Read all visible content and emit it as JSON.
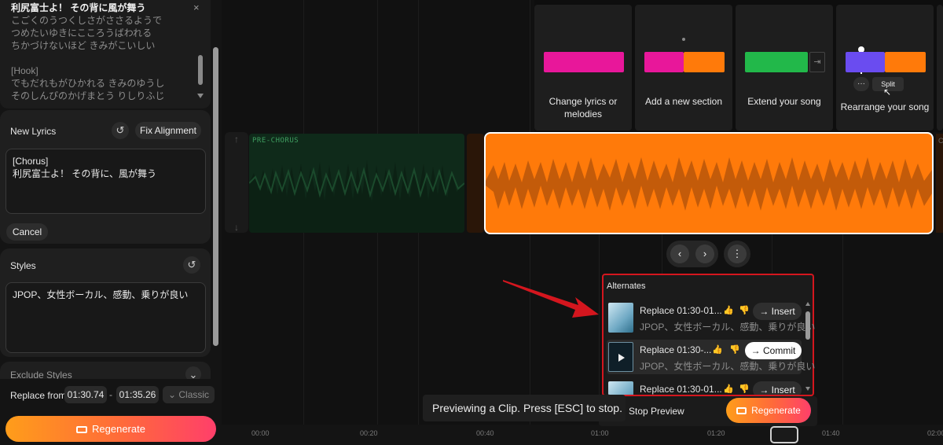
{
  "lyrics_panel": {
    "lines": [
      "利尻富士よ！ その背に風が舞う",
      "こごくのうつくしさがささるようで",
      "つめたいゆきにこころうばわれる",
      "ちかづけないほど きみがこいしい",
      "",
      "[Hook]",
      "でもだれもがひかれる きみのゆうし",
      "そのしんぴのかげまとう りしりふじ"
    ],
    "close_glyph": "×"
  },
  "new_lyrics": {
    "title": "New Lyrics",
    "undo_glyph": "↺",
    "fix_alignment_label": "Fix Alignment",
    "text_line1": "[Chorus]",
    "text_line2": "利尻富士よ！ その背に、風が舞う",
    "cancel_label": "Cancel"
  },
  "styles": {
    "title": "Styles",
    "undo_glyph": "↺",
    "value": "JPOP、女性ボーカル、感動、乗りが良い"
  },
  "exclude_styles": {
    "title": "Exclude Styles",
    "chevron_glyph": "⌄"
  },
  "replace": {
    "label": "Replace from",
    "from": "01:30.74",
    "separator": "-",
    "to": "01:35.26",
    "mode": "⌄ Classic"
  },
  "regenerate_label": "Regenerate",
  "timeline": {
    "track_label": "PRE-CHORUS",
    "gutter_up": "↑",
    "gutter_down": "↓",
    "nav_prev": "‹",
    "nav_next": "›",
    "nav_more": "⋮",
    "right_label": "C",
    "ruler_labels": [
      "00:00",
      "00:20",
      "00:40",
      "01:00",
      "01:20",
      "01:40",
      "02:00"
    ]
  },
  "feature_cards": [
    {
      "label": "Change lyrics or melodies"
    },
    {
      "label": "Add a new section"
    },
    {
      "label": "Extend your song"
    },
    {
      "label": "Rearrange your song",
      "more_glyph": "···",
      "split_label": "Split"
    }
  ],
  "alternates": {
    "title": "Alternates",
    "items": [
      {
        "title": "Replace 01:30-01...",
        "subtitle": "JPOP、女性ボーカル、感動、乗りが良い",
        "action": "→ Insert"
      },
      {
        "title": "Replace 01:30-...",
        "subtitle": "JPOP、女性ボーカル、感動、乗りが良い",
        "action": "→ Commit"
      },
      {
        "title": "Replace 01:30-01...",
        "subtitle": "",
        "action": "→ Insert"
      }
    ],
    "stop_preview_label": "Stop Preview"
  },
  "preview_message": "Previewing a Clip. Press [ESC] to stop.",
  "colors": {
    "orange": "#ff7a0a",
    "green_dark": "#0f2a1a",
    "pink": "#e8179a",
    "green": "#22b84a",
    "purple": "#6a4cf0",
    "arrow_red": "#d4161e"
  }
}
